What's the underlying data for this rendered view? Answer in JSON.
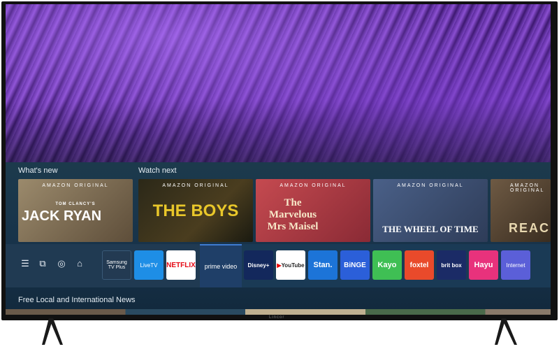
{
  "sections": {
    "whats_new": "What's new",
    "watch_next": "Watch next",
    "free_news": "Free Local and International News"
  },
  "cards": [
    {
      "badge": "AMAZON ORIGINAL",
      "title": "JACK RYAN",
      "pretitle": "TOM CLANCY'S",
      "color": "#7a6a55"
    },
    {
      "badge": "AMAZON ORIGINAL",
      "title": "THE BOYS",
      "color": "#3a3320"
    },
    {
      "badge": "AMAZON ORIGINAL",
      "title": "The Marvelous Mrs Maisel",
      "color": "#b63a45"
    },
    {
      "badge": "AMAZON ORIGINAL",
      "title": "THE WHEEL OF TIME",
      "color": "#3f5678"
    },
    {
      "badge": "AMAZON ORIGINAL",
      "title": "REACH",
      "color": "#5a4a38"
    }
  ],
  "nav_icons": [
    "menu-icon",
    "sources-icon",
    "ambient-icon",
    "home-icon"
  ],
  "apps": {
    "samsung": "Samsung TV Plus",
    "livetv": "LiveTV",
    "netflix": "NETFLIX",
    "prime": "prime video",
    "disney": "Disney+",
    "youtube": "YouTube",
    "stan": "Stan.",
    "binge": "BiNGE",
    "kayo": "Kayo",
    "foxtel": "foxtel",
    "britbox": "brit box",
    "hayu": "Hayu",
    "internet": "Internet"
  },
  "brand": "Lincor",
  "colors": {
    "netflix": "#e50914",
    "livetv": "#1e8ee6",
    "disney": "#13285c",
    "youtube": "#ffffff",
    "stan": "#1c74d8",
    "binge": "#2b5fd9",
    "kayo": "#3fbf54",
    "foxtel": "#e94a2b",
    "britbox": "#1b2b66",
    "hayu": "#e8327c",
    "internet": "#5b5fd8"
  }
}
